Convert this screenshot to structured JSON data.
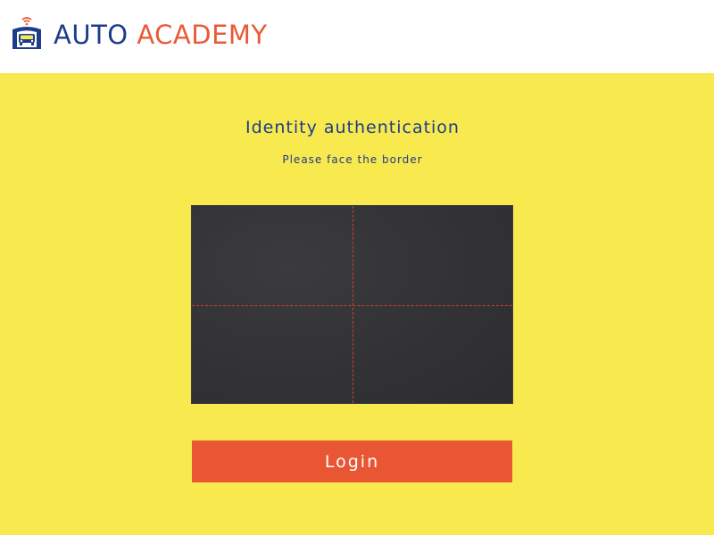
{
  "header": {
    "logo": {
      "icon": "car-garage-signal-icon",
      "brand_part_1": "AUTO",
      "brand_part_2": "ACADEMY"
    }
  },
  "auth": {
    "title": "Identity authentication",
    "instruction": "Please face the border",
    "camera": {
      "guides": "crosshair-dashed"
    },
    "login_label": "Login"
  },
  "colors": {
    "background": "#f8e94e",
    "brand_blue": "#1d3c8c",
    "brand_orange": "#ea5a35",
    "button": "#e85633",
    "camera_feed": "#343436",
    "guide_lines": "#c8402c"
  }
}
